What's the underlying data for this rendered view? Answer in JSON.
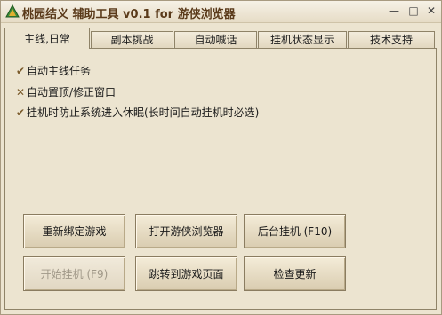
{
  "window": {
    "title": "桃园结义 辅助工具 v0.1 for 游侠浏览器"
  },
  "window_controls": {
    "minimize": "—",
    "maximize": "□",
    "close": "✕"
  },
  "tabs": [
    {
      "label": "主线,日常",
      "active": true
    },
    {
      "label": "副本挑战",
      "active": false
    },
    {
      "label": "自动喊话",
      "active": false
    },
    {
      "label": "挂机状态显示",
      "active": false
    },
    {
      "label": "技术支持",
      "active": false
    }
  ],
  "options": [
    {
      "label": "自动主线任务",
      "mark": "✔",
      "checked": true
    },
    {
      "label": "自动置顶/修正窗口",
      "mark": "✕",
      "checked": false
    },
    {
      "label": "挂机时防止系统进入休眠(长时间自动挂机时必选)",
      "mark": "✔",
      "checked": true
    }
  ],
  "buttons": {
    "rebind_game": "重新绑定游戏",
    "open_browser": "打开游侠浏览器",
    "background_hangup": "后台挂机 (F10)",
    "start_hangup": "开始挂机 (F9)",
    "goto_game_page": "跳转到游戏页面",
    "check_update": "检查更新"
  },
  "colors": {
    "panel_bg": "#ece4d0",
    "border": "#8f8368",
    "title_text": "#5a3a1a"
  }
}
